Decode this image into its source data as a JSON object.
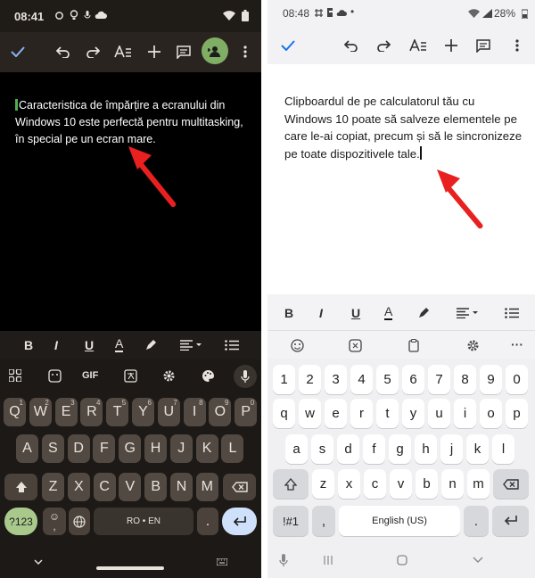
{
  "left": {
    "status": {
      "time": "08:41"
    },
    "document": {
      "text": "Caracteristica de împărțire a ecranului din Windows 10 este perfectă pentru multitasking, în special pe un ecran mare."
    },
    "keyboard": {
      "row1": [
        "Q",
        "W",
        "E",
        "R",
        "T",
        "Y",
        "U",
        "I",
        "O",
        "P"
      ],
      "row1_sup": [
        "1",
        "2",
        "3",
        "4",
        "5",
        "6",
        "7",
        "8",
        "9",
        "0"
      ],
      "row2": [
        "A",
        "S",
        "D",
        "F",
        "G",
        "H",
        "J",
        "K",
        "L"
      ],
      "row3": [
        "Z",
        "X",
        "C",
        "V",
        "B",
        "N",
        "M"
      ],
      "gif": "GIF",
      "symbols": "?123",
      "space": "RO • EN",
      "comma": ",",
      "period": "."
    },
    "format": {
      "bold": "B",
      "italic": "I",
      "underline": "U",
      "color": "A"
    }
  },
  "right": {
    "status": {
      "time": "08:48",
      "battery": "28%"
    },
    "document": {
      "text": "Clipboardul de pe calculatorul tău cu Windows 10 poate să salveze elementele pe care le-ai copiat, precum și să le sincronizeze pe toate dispozitivele tale."
    },
    "keyboard": {
      "numbers": [
        "1",
        "2",
        "3",
        "4",
        "5",
        "6",
        "7",
        "8",
        "9",
        "0"
      ],
      "row1": [
        "q",
        "w",
        "e",
        "r",
        "t",
        "y",
        "u",
        "i",
        "o",
        "p"
      ],
      "row2": [
        "a",
        "s",
        "d",
        "f",
        "g",
        "h",
        "j",
        "k",
        "l"
      ],
      "row3": [
        "z",
        "x",
        "c",
        "v",
        "b",
        "n",
        "m"
      ],
      "symbols": "!#1",
      "comma": ",",
      "space": "English (US)",
      "period": "."
    },
    "format": {
      "bold": "B",
      "italic": "I",
      "underline": "U",
      "color": "A"
    },
    "suggestion_more": "···"
  },
  "colors": {
    "accent_left": "#7fae64",
    "enter_left": "#cfe0fb",
    "arrow": "#e8201f",
    "check_right": "#1a73e8"
  }
}
